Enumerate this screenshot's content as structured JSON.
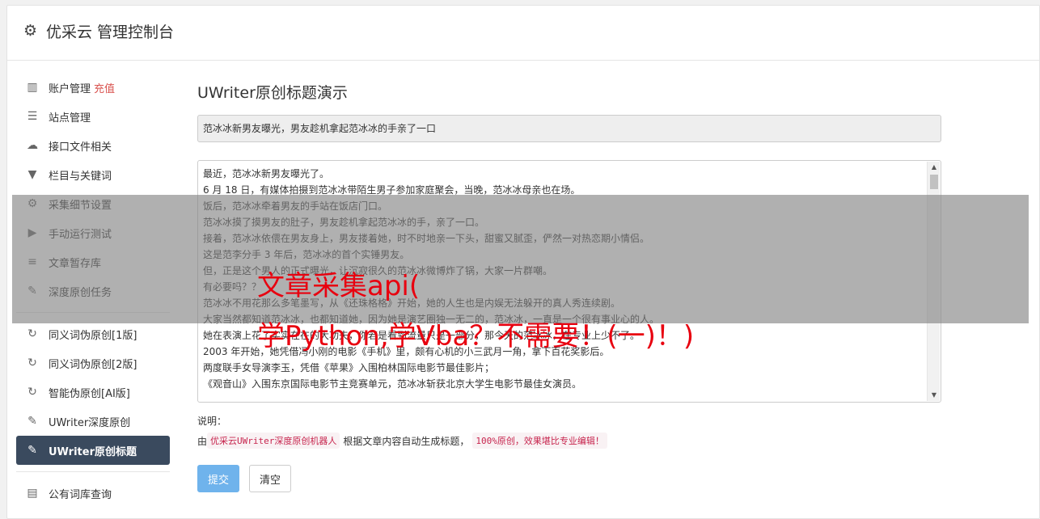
{
  "header": {
    "gear_icon": "gear-icon",
    "title": "优采云 管理控制台"
  },
  "sidebar": {
    "items": [
      {
        "icon": "▥",
        "icon_name": "bar-chart-icon",
        "label": "账户管理",
        "extra": "充值"
      },
      {
        "icon": "☰",
        "icon_name": "server-icon",
        "label": "站点管理"
      },
      {
        "icon": "☁",
        "icon_name": "cloud-upload-icon",
        "label": "接口文件相关"
      },
      {
        "icon": "▼",
        "icon_name": "filter-icon",
        "label": "栏目与关键词"
      },
      {
        "icon": "⚙",
        "icon_name": "cogs-icon",
        "label": "采集细节设置"
      },
      {
        "icon": "▶",
        "icon_name": "play-icon",
        "label": "手动运行测试"
      },
      {
        "icon": "≡",
        "icon_name": "database-icon",
        "label": "文章暂存库"
      },
      {
        "icon": "✎",
        "icon_name": "edit-icon",
        "label": "深度原创任务"
      }
    ],
    "items2": [
      {
        "icon": "↻",
        "icon_name": "refresh-icon",
        "label": "同义词伪原创[1版]"
      },
      {
        "icon": "↻",
        "icon_name": "refresh-icon",
        "label": "同义词伪原创[2版]"
      },
      {
        "icon": "↻",
        "icon_name": "refresh-icon",
        "label": "智能伪原创[AI版]"
      },
      {
        "icon": "✎",
        "icon_name": "edit-icon",
        "label": "UWriter深度原创"
      },
      {
        "icon": "✎",
        "icon_name": "edit-icon",
        "label": "UWriter原创标题"
      }
    ],
    "items3": [
      {
        "icon": "▤",
        "icon_name": "book-icon",
        "label": "公有词库查询"
      }
    ]
  },
  "main": {
    "title": "UWriter原创标题演示",
    "title_input": "范冰冰新男友曝光，男友趁机拿起范冰冰的手亲了一口",
    "content_lines": [
      "最近，范冰冰新男友曝光了。",
      "6 月 18 日，有媒体拍摄到范冰冰带陌生男子参加家庭聚会，当晚，范冰冰母亲也在场。",
      "饭后，范冰冰牵着男友的手站在饭店门口。",
      "范冰冰摸了摸男友的肚子，男友趁机拿起范冰冰的手，亲了一口。",
      "接着，范冰冰依偎在男友身上，男友搂着她，时不时地亲一下头，甜蜜又腻歪，俨然一对热恋期小情侣。",
      "这是范李分手 3 年后，范冰冰的首个实锤男友。",
      "但，正是这个男人的正式曝光，让沉寂很久的范冰冰微博炸了锅，大家一片群嘲。",
      "有必要吗？？",
      "范冰冰不用花那么多笔墨写，从《还珠格格》开始，她的人生也是内娱无法躲开的真人秀连续剧。",
      "大家当然都知道范冰冰，也都知道她，因为她是演艺圈独一无二的，范冰冰，一直是一个很有事业心的人。",
      "她在表演上花了实实在在的大功夫，你若是看到流量只是一部分，那今天的范冰冰，在专业上少不了。",
      "2003 年开始，她凭借冯小刚的电影《手机》里，颇有心机的小三武月一角，拿下百花奖影后。",
      "两度联手女导演李玉，凭借《苹果》入围柏林国际电影节最佳影片；",
      "《观音山》入围东京国际电影节主竞赛单元，范冰冰斩获北京大学生电影节最佳女演员。"
    ],
    "note_label": "说明：",
    "note_prefix": "由",
    "note_code1": "优采云UWriter深度原创机器人",
    "note_mid": "根据文章内容自动生成标题，",
    "note_code2": "100%原创，效果堪比专业编辑！",
    "submit": "提交",
    "clear": "清空"
  },
  "watermark": {
    "line1": "文章采集api(",
    "line2": "学Python,学Vba？不需要！(一)！)"
  }
}
